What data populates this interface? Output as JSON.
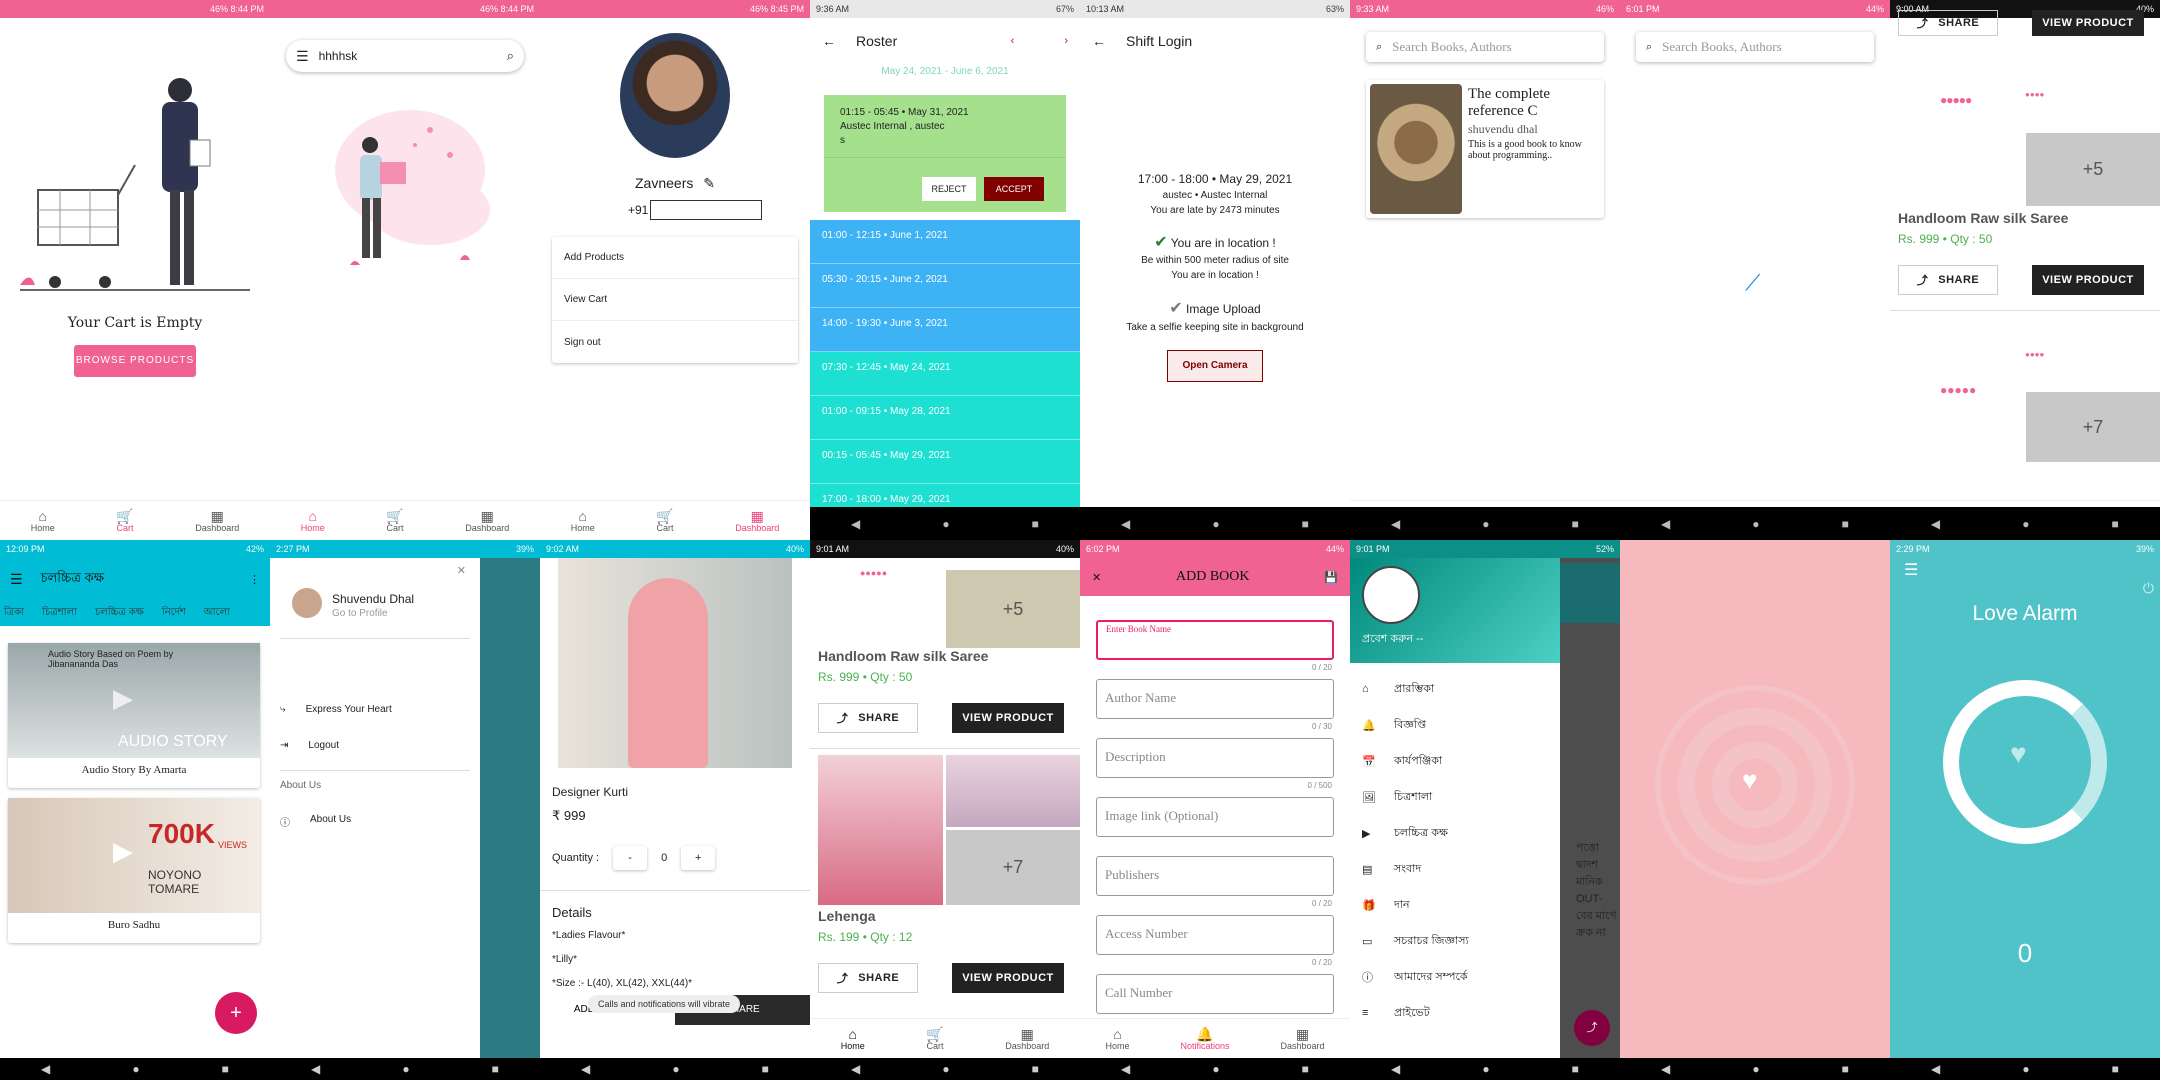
{
  "statusbar": {
    "p1": {
      "time": "",
      "right": "46% 8:44 PM"
    },
    "p2": {
      "time": "",
      "right": "46% 8:44 PM"
    },
    "p3": {
      "time": "",
      "right": "46% 8:45 PM"
    },
    "p4": {
      "time": "9:36 AM",
      "right": "67%"
    },
    "p5": {
      "time": "10:13 AM",
      "right": "63%"
    },
    "p6": {
      "time": "9:33 AM",
      "right": "46%"
    },
    "p7": {
      "time": "6:01 PM",
      "right": "44%"
    },
    "p8": {
      "time": "9:00 AM",
      "right": "40%"
    },
    "p9": {
      "time": "12:09 PM",
      "right": "42%"
    },
    "p10": {
      "time": "2:27 PM",
      "right": "39%"
    },
    "p11": {
      "time": "9:02 AM",
      "right": "40%"
    },
    "p12": {
      "time": "9:01 AM",
      "right": "40%"
    },
    "p13": {
      "time": "6:02 PM",
      "right": "44%"
    },
    "p14": {
      "time": "9:01 PM",
      "right": "52%"
    },
    "p15": {
      "time": "",
      "right": ""
    },
    "p16": {
      "time": "2:29 PM",
      "right": "39%"
    }
  },
  "nav": {
    "home": "Home",
    "cart": "Cart",
    "dashboard": "Dashboard",
    "notifications": "Notifications"
  },
  "cart": {
    "empty_text": "Your Cart is Empty",
    "browse_label": "BROWSE PRODUCTS"
  },
  "search": {
    "query": "hhhhsk"
  },
  "profile": {
    "name": "Zavneers",
    "phone_prefix": "+91",
    "menu": [
      "Add Products",
      "View Cart",
      "Sign out"
    ]
  },
  "roster": {
    "title": "Roster",
    "range": "May 24, 2021 - June 6, 2021",
    "pending": {
      "time": "01:15 - 05:45 • May 31, 2021",
      "org": "Austec Internal , austec",
      "note": "s",
      "reject": "REJECT",
      "accept": "ACCEPT"
    },
    "shifts": [
      {
        "label": "01:00 - 12:15 • June 1, 2021",
        "color": "#3db2f5"
      },
      {
        "label": "05:30 - 20:15 • June 2, 2021",
        "color": "#3db2f5"
      },
      {
        "label": "14:00 - 19:30 • June 3, 2021",
        "color": "#3db2f5"
      },
      {
        "label": "07:30 - 12:45 • May 24, 2021",
        "color": "#1de0d3"
      },
      {
        "label": "01:00 - 09:15 • May 28, 2021",
        "color": "#1de0d3"
      },
      {
        "label": "00:15 - 05:45 • May 29, 2021",
        "color": "#1de0d3"
      },
      {
        "label": "17:00 - 18:00 • May 29, 2021",
        "color": "#1de0d3"
      }
    ]
  },
  "shift_login": {
    "title": "Shift Login",
    "time": "17:00 - 18:00 • May 29, 2021",
    "org": "austec • Austec Internal",
    "late": "You are late by 2473 minutes",
    "loc_status": "You are in location !",
    "loc_hint": "Be within 500 meter radius of site",
    "loc_hint2": "You are in location !",
    "upload_title": "Image Upload",
    "upload_hint": "Take a selfie keeping site in background",
    "camera_btn": "Open Camera"
  },
  "books": {
    "search_placeholder": "Search Books, Authors",
    "title": "The complete reference C",
    "author": "shuvendu dhal",
    "desc": "This is a good book to know about programming.."
  },
  "products": {
    "share": "SHARE",
    "view": "VIEW PRODUCT",
    "saree_name": "Handloom Raw silk Saree",
    "saree_price": "Rs. 999",
    "saree_qty": "Qty : 50",
    "more1": "+5",
    "more2": "+7",
    "lehenga_name": "Lehenga",
    "lehenga_price": "Rs. 199",
    "lehenga_qty": "Qty : 12"
  },
  "audio": {
    "title": "চলচ্চিত্র কক্ষ",
    "tabs": [
      "ত্রিকা",
      "চিত্রশালা",
      "চলচ্চিত্র কক্ষ",
      "নির্দেশ",
      "আলো"
    ],
    "card1_overlay": "Audio Story Based on Poem by Jibanananda Das",
    "card1_sub": "AUDIO STORY",
    "card1": "Audio Story By Amarta",
    "card2_big": "700K",
    "card2_views": "VIEWS",
    "card2_name": "NOYONO TOMARE",
    "card2": "Buro Sadhu"
  },
  "drawer1": {
    "name": "Shuvendu Dhal",
    "sub": "Go to Profile",
    "items": [
      "Express Your Heart",
      "Logout"
    ],
    "section": "About Us",
    "about": "About Us"
  },
  "kurti": {
    "name": "Designer Kurti",
    "price": "₹ 999",
    "qty_label": "Quantity :",
    "qty": "0",
    "minus": "-",
    "plus": "+",
    "details_title": "Details",
    "details": [
      "*Ladies Flavour*",
      "*Lilly*",
      "*Size :- L(40), XL(42), XXL(44)*"
    ],
    "toast": "Calls and notifications will vibrate",
    "add": "ADD TO CART",
    "share": "SHARE"
  },
  "addbook": {
    "title": "ADD BOOK",
    "fields": [
      {
        "label": "Enter Book Name",
        "count": "0 / 20"
      },
      {
        "label": "Author Name",
        "count": "0 / 30"
      },
      {
        "label": "Description",
        "count": "0 / 500"
      },
      {
        "label": "Image link (Optional)",
        "count": ""
      },
      {
        "label": "Publishers",
        "count": "0 / 20"
      },
      {
        "label": "Access Number",
        "count": "0 / 20"
      },
      {
        "label": "Call Number",
        "count": ""
      }
    ]
  },
  "drawer2": {
    "login": "প্রবেশ করুন --",
    "items": [
      "প্রারম্ভিকা",
      "বিজ্ঞপ্তি",
      "কার্যপঞ্জিকা",
      "চিত্রশালা",
      "চলচ্চিত্র কক্ষ",
      "সংবাদ",
      "দান",
      "সচরাচর জিজ্ঞাস্য",
      "আমাদের সম্পর্কে",
      "প্রাইভেট"
    ],
    "bg_text": "পত্তো দ্বাদশ মানিক OUT- বের মাগে ক্রক না"
  },
  "love": {
    "title": "Love Alarm",
    "count": "0"
  },
  "colors": {
    "pink": "#f06292",
    "cyan": "#00bcd4",
    "green": "#a5e08d",
    "maroon": "#800000"
  }
}
